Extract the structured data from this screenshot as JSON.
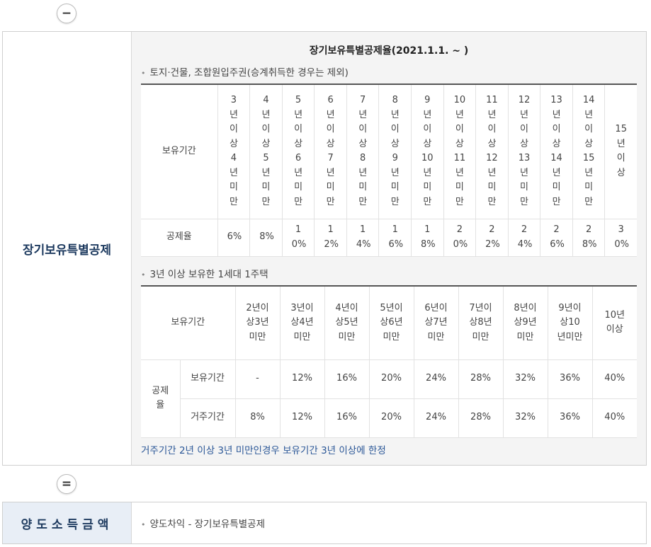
{
  "minus_symbol": "−",
  "equals_symbol": "=",
  "section1": {
    "label": "장기보유특별공제",
    "title": "장기보유특별공제율(2021.1.1. ~ )",
    "bullet1": "토지·건물, 조합원입주권(승계취득한 경우는 제외)",
    "table1": {
      "head_label": "보유기간",
      "periods": [
        "3년이상4년미만",
        "4년이상5년미만",
        "5년이상6년미만",
        "6년이상7년미만",
        "7년이상8년미만",
        "8년이상9년미만",
        "9년이상10년미만",
        "10년이상11년미만",
        "11년이상12년미만",
        "12년이상13년미만",
        "13년이상14년미만",
        "14년이상15년미만",
        "15년이상"
      ],
      "rate_label": "공제율",
      "rates": [
        "6%",
        "8%",
        "10%",
        "12%",
        "14%",
        "16%",
        "18%",
        "20%",
        "22%",
        "24%",
        "26%",
        "28%",
        "30%"
      ]
    },
    "bullet2": "3년 이상 보유한 1세대 1주택",
    "table2": {
      "head_label": "보유기간",
      "periods": [
        "2년이상3년미만",
        "3년이상4년미만",
        "4년이상5년미만",
        "5년이상6년미만",
        "6년이상7년미만",
        "7년이상8년미만",
        "8년이상9년미만",
        "9년이상10년미만",
        "10년이상"
      ],
      "rate_label": "공제율",
      "row1_label": "보유기간",
      "row1": [
        "-",
        "12%",
        "16%",
        "20%",
        "24%",
        "28%",
        "32%",
        "36%",
        "40%"
      ],
      "row2_label": "거주기간",
      "row2": [
        "8%",
        "12%",
        "16%",
        "20%",
        "24%",
        "28%",
        "32%",
        "36%",
        "40%"
      ]
    },
    "note": "거주기간 2년 이상 3년 미만인경우 보유기간 3년 이상에 한정"
  },
  "section2": {
    "label": "양도소득금액",
    "bullet": "양도차익 - 장기보유특별공제"
  }
}
